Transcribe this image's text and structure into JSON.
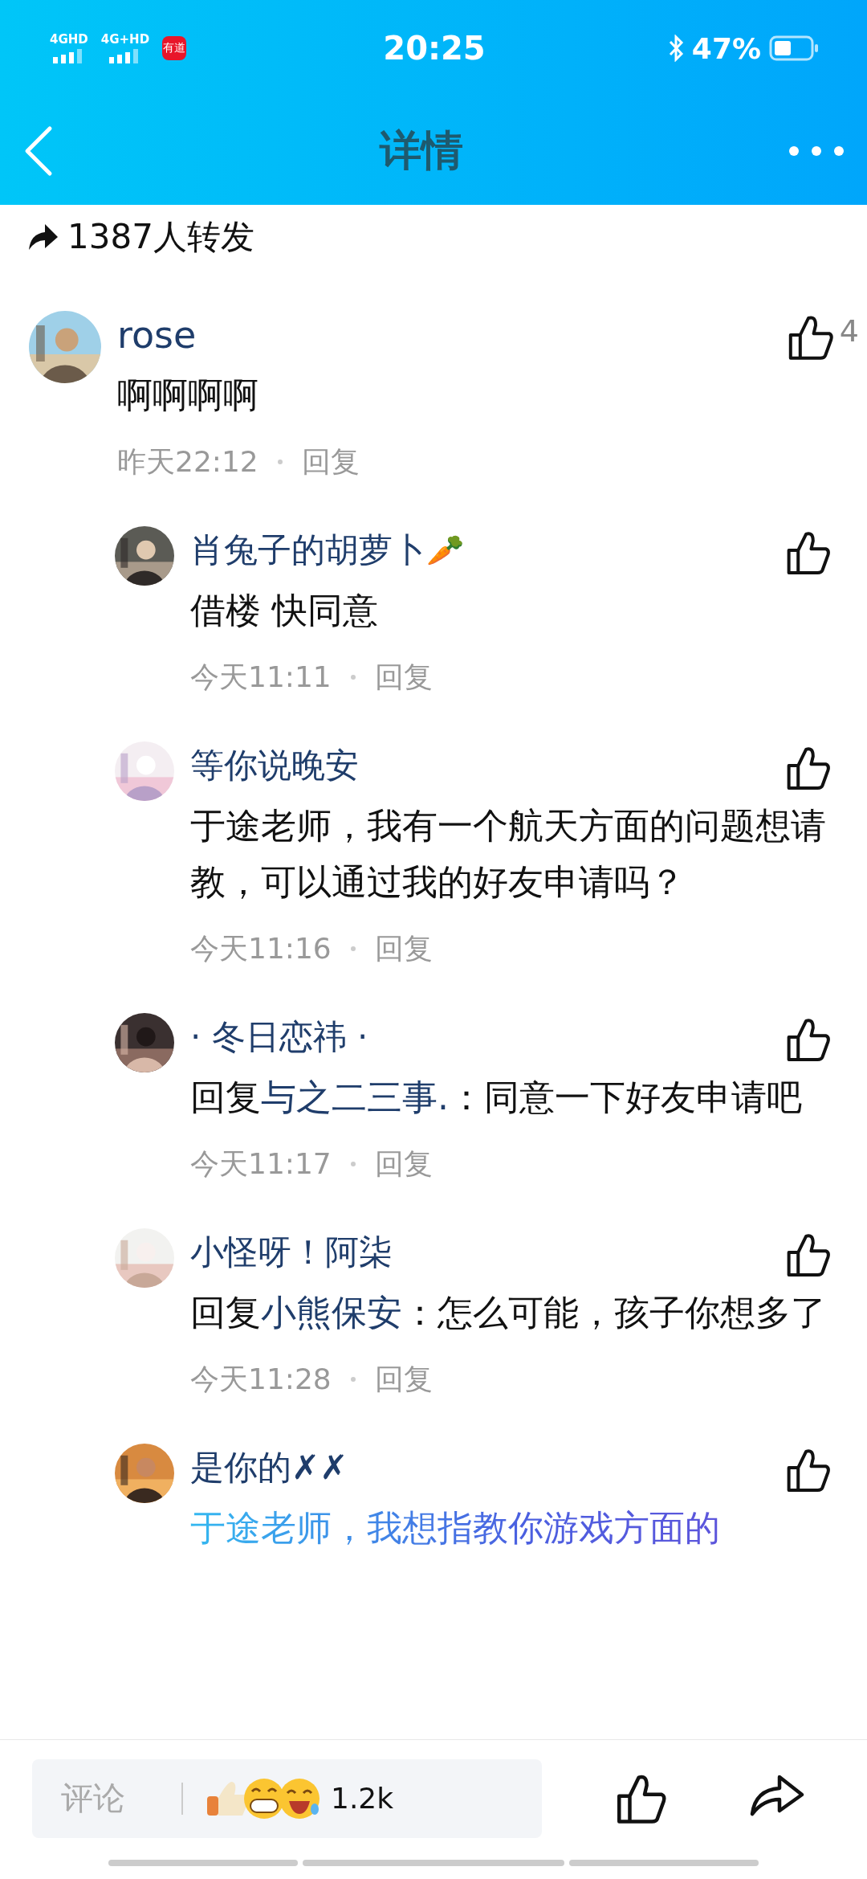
{
  "status_bar": {
    "network_1": "4GHD",
    "network_2": "4G+HD",
    "app_badge": "有道",
    "time": "20:25",
    "battery": "47%"
  },
  "nav": {
    "title": "详情"
  },
  "shares": {
    "text": "1387人转发"
  },
  "comments": [
    {
      "name": "rose",
      "text": "啊啊啊啊",
      "time": "昨天22:12",
      "reply": "回复",
      "likes": "4",
      "children": [
        {
          "name": "肖兔子的胡萝卜",
          "name_emoji": "🥕",
          "text": "借楼 快同意",
          "time": "今天11:11",
          "reply": "回复"
        },
        {
          "name": "等你说晚安",
          "text": "于途老师，我有一个航天方面的问题想请教，可以通过我的好友申请吗？",
          "time": "今天11:16",
          "reply": "回复"
        },
        {
          "name": "· 冬日恋祎 ·",
          "reply_prefix": "回复",
          "reply_to": "与之二三事.",
          "text": "：同意一下好友申请吧",
          "time": "今天11:17",
          "reply": "回复"
        },
        {
          "name": "小怪呀！阿柒",
          "reply_prefix": "回复",
          "reply_to": "小熊保安",
          "text": "：怎么可能，孩子你想多了",
          "time": "今天11:28",
          "reply": "回复"
        },
        {
          "name": "是你的✗✗",
          "text": "于途老师，我想指教你游戏方面的",
          "fancy": true
        }
      ]
    }
  ],
  "bottom_bar": {
    "placeholder": "评论",
    "reaction_count": "1.2k"
  }
}
